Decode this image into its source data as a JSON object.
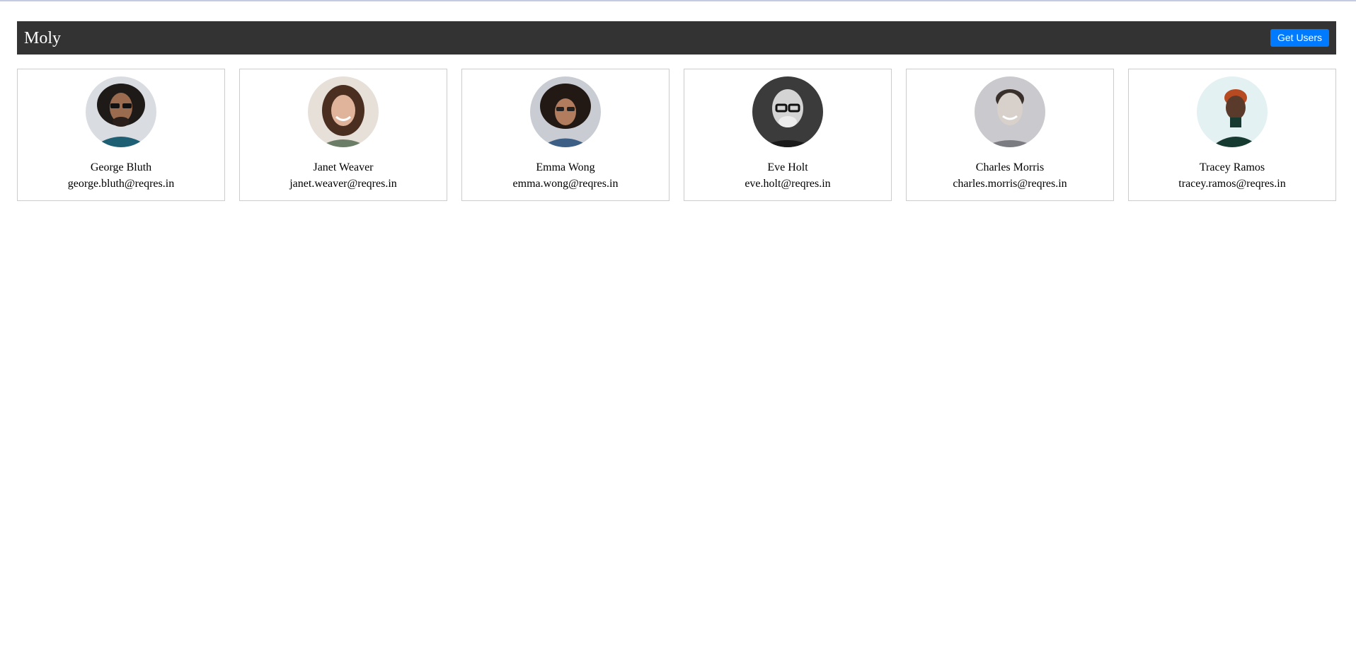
{
  "navbar": {
    "brand": "Moly",
    "get_users_label": "Get Users"
  },
  "users": [
    {
      "name": "George Bluth",
      "email": "george.bluth@reqres.in"
    },
    {
      "name": "Janet Weaver",
      "email": "janet.weaver@reqres.in"
    },
    {
      "name": "Emma Wong",
      "email": "emma.wong@reqres.in"
    },
    {
      "name": "Eve Holt",
      "email": "eve.holt@reqres.in"
    },
    {
      "name": "Charles Morris",
      "email": "charles.morris@reqres.in"
    },
    {
      "name": "Tracey Ramos",
      "email": "tracey.ramos@reqres.in"
    }
  ],
  "colors": {
    "navbar_bg": "#333333",
    "button_bg": "#007bff",
    "card_border": "#cccccc"
  }
}
